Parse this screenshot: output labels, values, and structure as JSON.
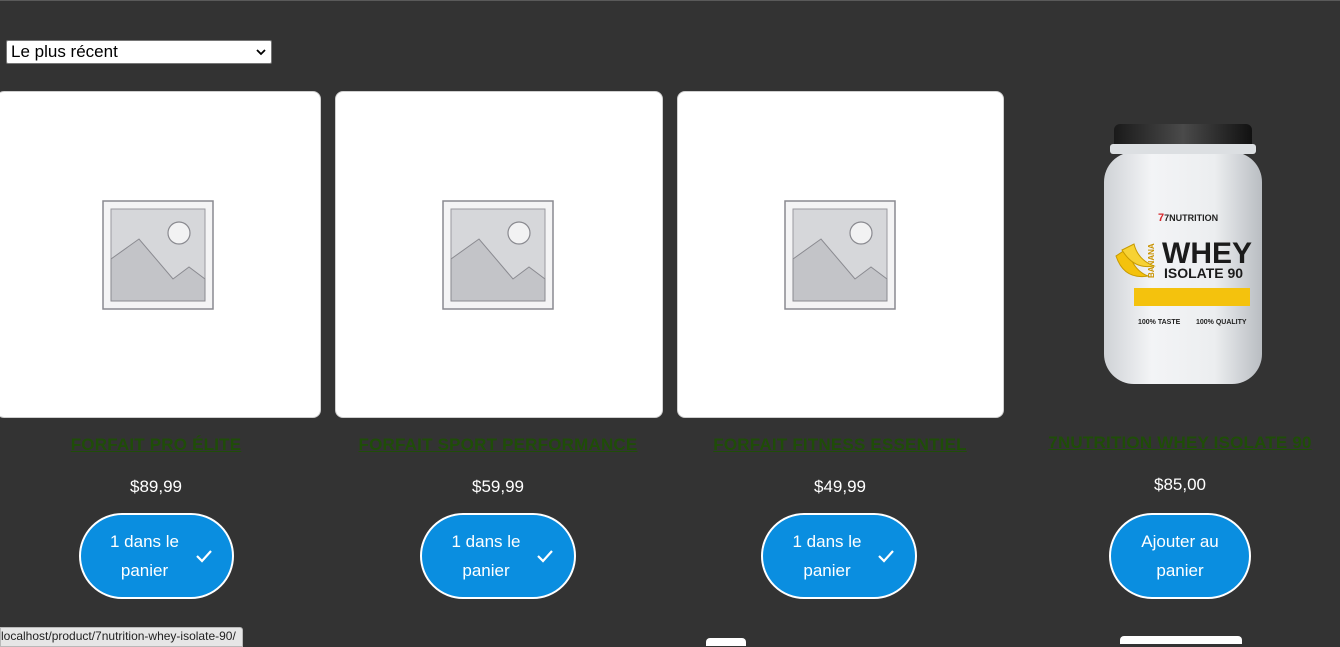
{
  "sort": {
    "selected": "Le plus récent"
  },
  "products": [
    {
      "title": "FORFAIT PRO ÉLITE",
      "price": "$89,99",
      "button": [
        "1 dans le",
        "panier"
      ],
      "in_cart": true,
      "image": "placeholder-icon"
    },
    {
      "title": "FORFAIT SPORT PERFORMANCE",
      "price": "$59,99",
      "button": [
        "1 dans le",
        "panier"
      ],
      "in_cart": true,
      "image": "placeholder-icon"
    },
    {
      "title": "FORFAIT FITNESS ESSENTIEL",
      "price": "$49,99",
      "button": [
        "1 dans le",
        "panier"
      ],
      "in_cart": true,
      "image": "placeholder-icon"
    },
    {
      "title": "7NUTRITION WHEY ISOLATE 90",
      "price": "$85,00",
      "button": [
        "Ajouter au",
        "panier"
      ],
      "in_cart": false,
      "image": "whey-tub-image",
      "image_text": {
        "brand": "7NUTRITION",
        "line1": "WHEY",
        "line2": "ISOLATE 90",
        "flavor": "BANANA",
        "badge1": "100% TASTE",
        "badge2": "100% QUALITY"
      }
    }
  ],
  "status_bar": {
    "url": "localhost/product/7nutrition-whey-isolate-90/"
  },
  "colors": {
    "background": "#333333",
    "title_link": "#1f4d08",
    "button": "#0a8ee0",
    "text": "#ffffff"
  }
}
